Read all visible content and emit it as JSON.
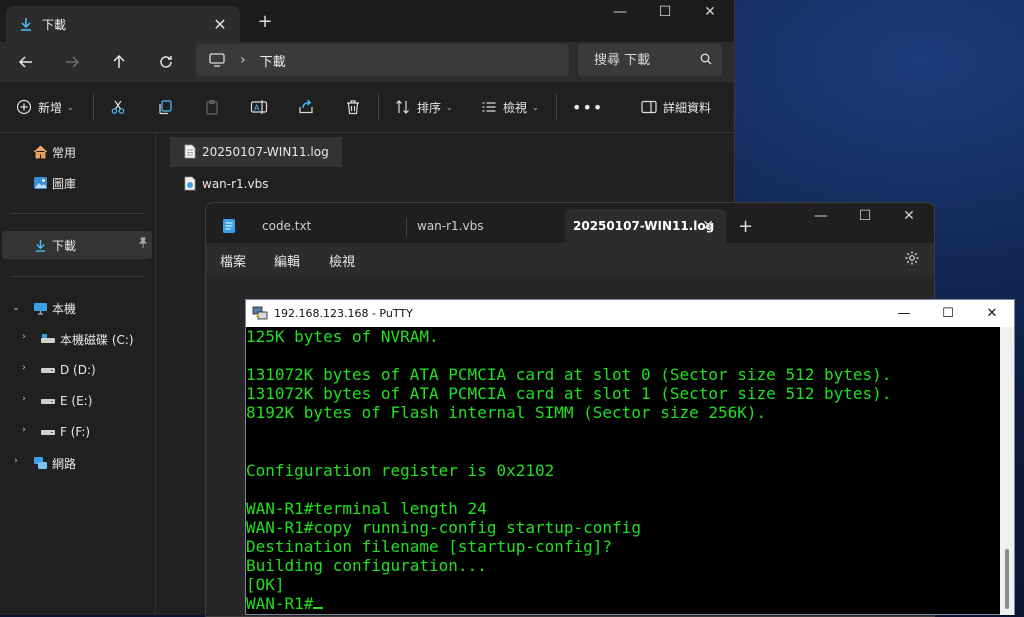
{
  "explorer": {
    "tab_title": "下載",
    "address_crumb": "下載",
    "search_placeholder": "搜尋 下載",
    "commands": {
      "new_label": "新增",
      "sort_label": "排序",
      "view_label": "檢視",
      "details_label": "詳細資料"
    },
    "sidebar": {
      "home": "常用",
      "gallery": "圖庫",
      "downloads": "下載",
      "this_pc": "本機",
      "drives": [
        {
          "label": "本機磁碟 (C:)"
        },
        {
          "label": "D (D:)"
        },
        {
          "label": "E (E:)"
        },
        {
          "label": "F (F:)"
        }
      ],
      "network": "網路"
    },
    "files": [
      {
        "name": "20250107-WIN11.log",
        "selected": true
      },
      {
        "name": "wan-r1.vbs",
        "selected": false
      }
    ]
  },
  "notepad": {
    "tabs": [
      {
        "label": "code.txt"
      },
      {
        "label": "wan-r1.vbs"
      },
      {
        "label": "20250107-WIN11.log"
      }
    ],
    "menu": {
      "file": "檔案",
      "edit": "編輯",
      "view": "檢視"
    }
  },
  "putty": {
    "title": "192.168.123.168 - PuTTY",
    "terminal_lines": [
      "125K bytes of NVRAM.",
      "",
      "131072K bytes of ATA PCMCIA card at slot 0 (Sector size 512 bytes).",
      "131072K bytes of ATA PCMCIA card at slot 1 (Sector size 512 bytes).",
      "8192K bytes of Flash internal SIMM (Sector size 256K).",
      "",
      "",
      "Configuration register is 0x2102",
      "",
      "WAN-R1#terminal length 24",
      "WAN-R1#copy running-config startup-config",
      "Destination filename [startup-config]?",
      "Building configuration...",
      "[OK]"
    ],
    "prompt": "WAN-R1#"
  },
  "colors": {
    "terminal_text": "#20e020",
    "accent": "#4cc2ff"
  }
}
